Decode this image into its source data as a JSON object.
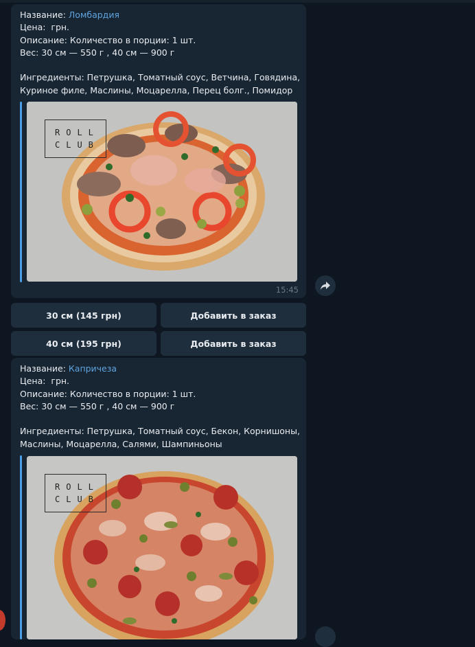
{
  "messages": [
    {
      "name_label": "Название: ",
      "name_value": "Ломбардия",
      "price": "Цена:  грн.",
      "description": "Описание: Количество в порции: 1 шт.",
      "weight": "Вес: 30 см — 550 г , 40 см — 900 г",
      "ingredients": "Ингредиенты: Петрушка, Томатный соус, Ветчина, Говядина, Куриное филе, Маслины, Моцарелла, Перец болг., Помидор",
      "logo_line1": "ROLL",
      "logo_line2": "CLUB",
      "time": "15:45"
    },
    {
      "name_label": "Название: ",
      "name_value": "Капричеза",
      "price": "Цена:  грн.",
      "description": "Описание: Количество в порции: 1 шт.",
      "weight": "Вес: 30 см — 550 г , 40 см — 900 г",
      "ingredients": "Ингредиенты: Петрушка, Томатный соус, Бекон, Корнишоны, Маслины, Моцарелла, Салями, Шампиньоны",
      "logo_line1": "ROLL",
      "logo_line2": "CLUB"
    }
  ],
  "keyboard": [
    {
      "size": "30 см (145 грн)",
      "add": "Добавить в заказ"
    },
    {
      "size": "40 см (195 грн)",
      "add": "Добавить в заказ"
    }
  ],
  "colors": {
    "background": "#0e1621",
    "bubble": "#182533",
    "link": "#5fa5df",
    "accent": "#4a9fe6"
  },
  "icons": {
    "share": "share-arrow-icon"
  }
}
